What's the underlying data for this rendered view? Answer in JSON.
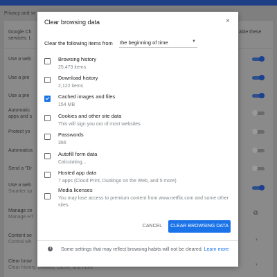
{
  "background": {
    "heading": "Privacy and se",
    "rows": [
      {
        "label": "Google Ch",
        "sub": "services. L"
      },
      {
        "label": "Use a web"
      },
      {
        "label": "Use a pre"
      },
      {
        "label": "Use a pre"
      },
      {
        "label": "Automatic",
        "sub": "apps and s"
      },
      {
        "label": "Protect yo"
      },
      {
        "label": "Automatica"
      },
      {
        "label": "Send a \"Dr"
      },
      {
        "label": "Use a web",
        "sub": "Smarter sp"
      },
      {
        "label": "Manage ce",
        "sub": "Manage HT"
      },
      {
        "label": "Content se",
        "sub": "Control wh"
      },
      {
        "label": "Clear brow",
        "sub": "Clear history, cookies, cache, and more"
      }
    ],
    "right_text": [
      "able these",
      ""
    ]
  },
  "dialog": {
    "title": "Clear browsing data",
    "close_glyph": "×",
    "range_label": "Clear the following items from",
    "range_value": "the beginning of time",
    "range_caret": "▼",
    "items": [
      {
        "label": "Browsing history",
        "sub": "25,473 items",
        "checked": false
      },
      {
        "label": "Download history",
        "sub": "2,122 items",
        "checked": false
      },
      {
        "label": "Cached images and files",
        "sub": "154 MB",
        "checked": true
      },
      {
        "label": "Cookies and other site data",
        "sub": "This will sign you out of most websites.",
        "checked": false
      },
      {
        "label": "Passwords",
        "sub": "366",
        "checked": false
      },
      {
        "label": "Autofill form data",
        "sub": "Calculating...",
        "checked": false
      },
      {
        "label": "Hosted app data",
        "sub": "7 apps (Cloud Print, Duolingo on the Web, and 5 more)",
        "checked": false
      },
      {
        "label": "Media licenses",
        "sub": "You may lose access to premium content from www.netflix.com and some other sites.",
        "checked": false
      }
    ],
    "cancel_label": "CANCEL",
    "clear_label": "CLEAR BROWSING DATA",
    "footer_text": "Some settings that may reflect browsing habits will not be cleared.",
    "footer_link": "Learn more",
    "info_glyph": "i"
  },
  "colors": {
    "accent": "#1a73e8",
    "overlay": "#7f7f7f"
  }
}
